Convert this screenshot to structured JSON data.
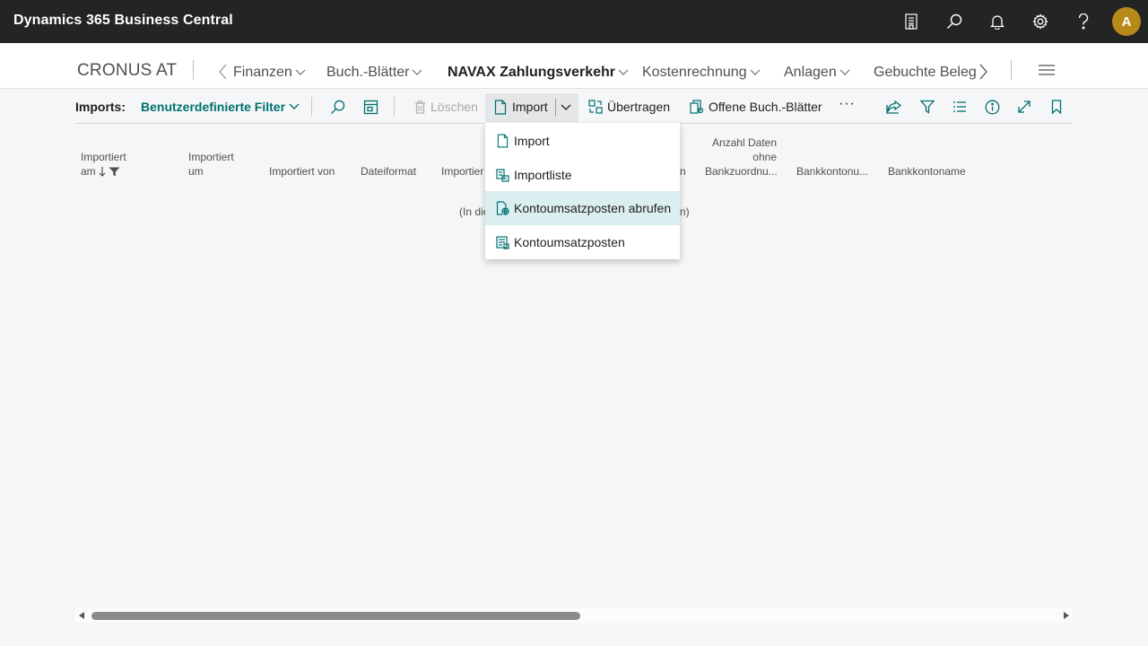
{
  "app": {
    "title": "Dynamics 365 Business Central",
    "avatar_initial": "A"
  },
  "appbar_icons": [
    "report-icon",
    "search-icon",
    "bell-icon",
    "gear-icon",
    "help-icon"
  ],
  "nav": {
    "company": "CRONUS AT",
    "items": [
      {
        "label": "Finanzen",
        "active": false
      },
      {
        "label": "Buch.-Blätter",
        "active": false
      },
      {
        "label": "NAVAX Zahlungsverkehr",
        "active": true
      },
      {
        "label": "Kostenrechnung",
        "active": false
      },
      {
        "label": "Anlagen",
        "active": false
      },
      {
        "label": "Gebuchte Beleg",
        "active": false
      }
    ]
  },
  "actionbar": {
    "label": "Imports:",
    "filter": "Benutzerdefinierte Filter",
    "delete_label": "Löschen",
    "import_label": "Import",
    "transfer_label": "Übertragen",
    "open_journals_label": "Offene Buch.-Blätter",
    "more_label": "···"
  },
  "table": {
    "headers": {
      "imported_on_1": "Importiert",
      "imported_on_2": "am",
      "imported_at_1": "Importiert",
      "imported_at_2": "um",
      "imported_by": "Importiert von",
      "file_format": "Dateiformat",
      "importing": "Importier",
      "col_n": "n",
      "count_1": "Anzahl Daten",
      "count_2": "ohne",
      "count_3": "Bankzuordnu...",
      "bank_account_no": "Bankkontonu...",
      "bank_account_name": "Bankkontoname"
    },
    "empty_left": "(In die",
    "empty_right": "n)"
  },
  "import_menu": {
    "items": [
      {
        "label": "Import",
        "icon": "document-icon"
      },
      {
        "label": "Importliste",
        "icon": "list-import-icon"
      },
      {
        "label": "Kontoumsatzposten abrufen",
        "icon": "web-fetch-icon"
      },
      {
        "label": "Kontoumsatzposten",
        "icon": "ledger-icon"
      }
    ],
    "highlighted_index": 2
  },
  "colors": {
    "accent": "#00716f",
    "appbar": "#242424",
    "avatar": "#b5891a",
    "menu_highlight": "#dbeef0"
  }
}
